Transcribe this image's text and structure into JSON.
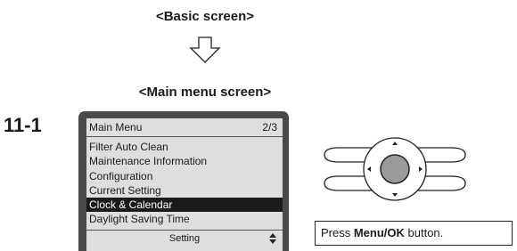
{
  "headings": {
    "basic": "<Basic screen>",
    "main": "<Main menu screen>"
  },
  "step": "11-1",
  "lcd": {
    "title": "Main Menu",
    "page": "2/3",
    "items": [
      "Filter Auto Clean",
      "Maintenance Information",
      "Configuration",
      "Current Setting",
      "Clock & Calendar",
      "Daylight Saving Time"
    ],
    "selected_index": 4,
    "footer": "Setting"
  },
  "caption": {
    "prefix": "Press ",
    "button_name": "Menu/OK",
    "suffix": " button."
  },
  "icons": {
    "arrow": "down-arrow-icon",
    "scroll": "up-down-arrows-icon",
    "controller": "remote-controller-icon"
  }
}
